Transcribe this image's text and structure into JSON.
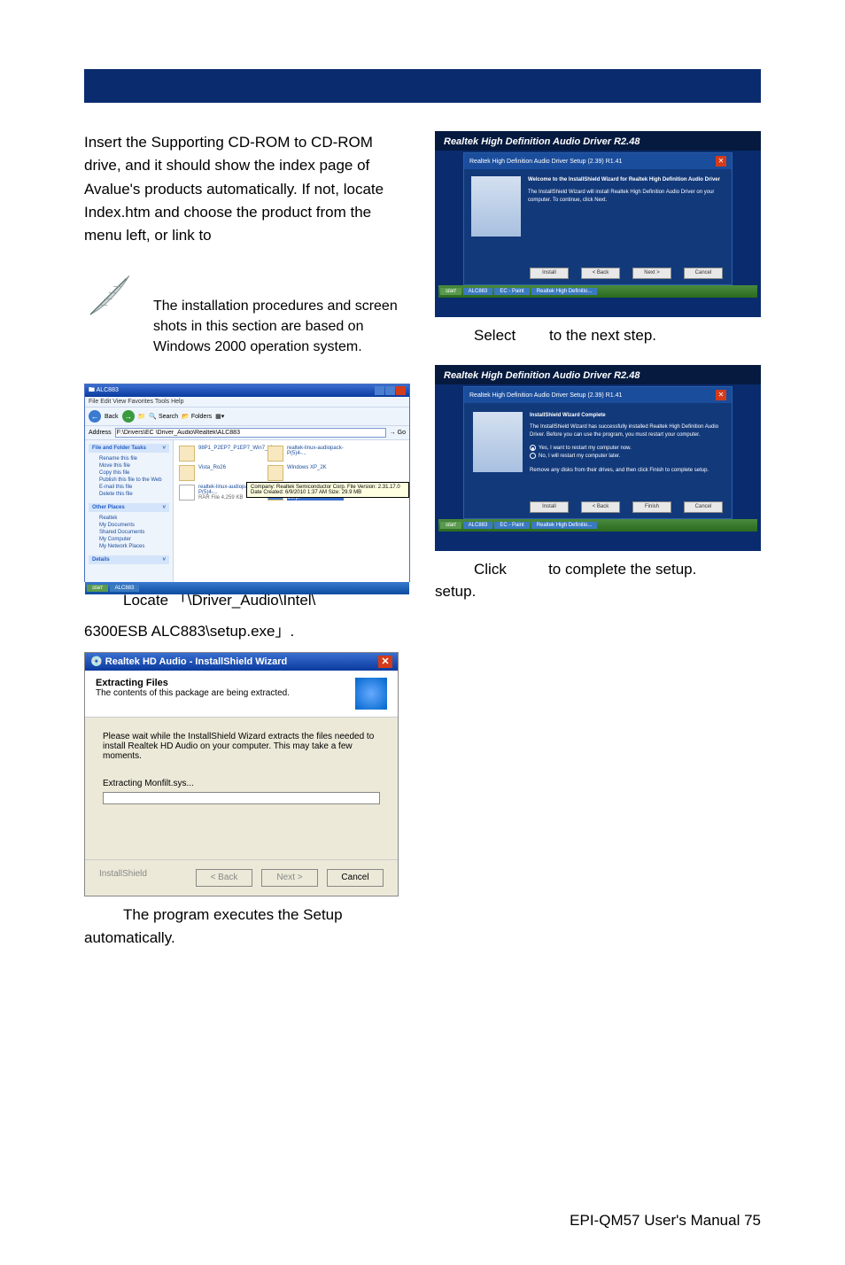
{
  "intro": "Insert the Supporting CD-ROM to CD-ROM drive, and it should show the index page of Avalue's products automatically. If not, locate Index.htm and choose the product from the menu left, or link to",
  "note": "The installation procedures and screen shots in this section are based on Windows 2000 operation system.",
  "step2_locate_a": "Locate 「\\Driver_Audio\\Intel\\",
  "step2_locate_b": "6300ESB ALC883\\setup.exe」.",
  "step3": "The program executes the Setup automatically.",
  "step4_a": "Select",
  "step4_b": "to the next step.",
  "step5_a": "Click",
  "step5_b": "to complete the setup.",
  "audio": {
    "title": "Realtek High Definition Audio Driver R2.48",
    "inner_title": "Realtek High Definition Audio Driver Setup (2.39) R1.41",
    "welcome_head": "Welcome to the InstallShield Wizard for Realtek High Definition Audio Driver",
    "welcome_body": "The InstallShield Wizard will install Realtek High Definition Audio Driver on your computer. To continue, click Next.",
    "btn_back": "< Back",
    "btn_next": "Next >",
    "btn_cancel": "Cancel",
    "btn_install": "Install"
  },
  "complete": {
    "head": "InstallShield Wizard Complete",
    "body": "The InstallShield Wizard has successfully installed Realtek High Definition Audio Driver. Before you can use the program, you must restart your computer.",
    "opt1": "Yes, I want to restart my computer now.",
    "opt2": "No, I will restart my computer later.",
    "remove": "Remove any disks from their drives, and then click Finish to complete setup.",
    "btn_finish": "Finish"
  },
  "taskbar": {
    "start": "start",
    "item1": "ALC883",
    "item2": "EC - Paint",
    "item3": "Realtek High Definitio..."
  },
  "explorer": {
    "title": "ALC883",
    "menu": "File  Edit  View  Favorites  Tools  Help",
    "back": "Back",
    "search": "Search",
    "folders": "Folders",
    "address_label": "Address",
    "address": "F:\\Drivers\\EC \\Driver_Audio\\Realtek\\ALC883",
    "go": "Go",
    "panel1_head": "File and Folder Tasks",
    "panel1_items": [
      "Rename this file",
      "Move this file",
      "Copy this file",
      "Publish this file to the Web",
      "E-mail this file",
      "Delete this file"
    ],
    "panel2_head": "Other Places",
    "panel2_items": [
      "Realtek",
      "My Documents",
      "Shared Documents",
      "My Computer",
      "My Network Places"
    ],
    "panel3_head": "Details",
    "files": [
      {
        "name": "98P1_P2EP7_P1EP7_Win7_Vis...",
        "type": "folder"
      },
      {
        "name": "realtek-linux-audiopack-P(5)4-...",
        "type": "folder"
      },
      {
        "name": "Vista_Ro26",
        "type": "folder"
      },
      {
        "name": "Windows XP_2K",
        "type": "folder"
      },
      {
        "name": "realtek-linux-audiopack-P(5)4-...",
        "sub": "RAR File\n4,259 KB",
        "type": "ini"
      },
      {
        "name": "WDM_R248",
        "sub": "Realtek Semiconductor Corp.",
        "type": "sel",
        "selected": true
      }
    ],
    "tooltip": "Company: Realtek Semiconductor Corp.\nFile Version: 2.31.17.0\nDate Created: 6/9/2010 1:37 AM\nSize: 29.9 MB"
  },
  "wizard": {
    "title": "Realtek HD Audio - InstallShield Wizard",
    "head_bold": "Extracting Files",
    "head_sub": "The contents of this package are being extracted.",
    "msg": "Please wait while the InstallShield Wizard extracts the files needed to install Realtek HD Audio on your computer.  This may take a few moments.",
    "extracting": "Extracting Monfilt.sys...",
    "btn_back": "< Back",
    "btn_next": "Next >",
    "btn_cancel": "Cancel",
    "ishield": "InstallShield"
  },
  "footer": "EPI-QM57  User's  Manual 75"
}
